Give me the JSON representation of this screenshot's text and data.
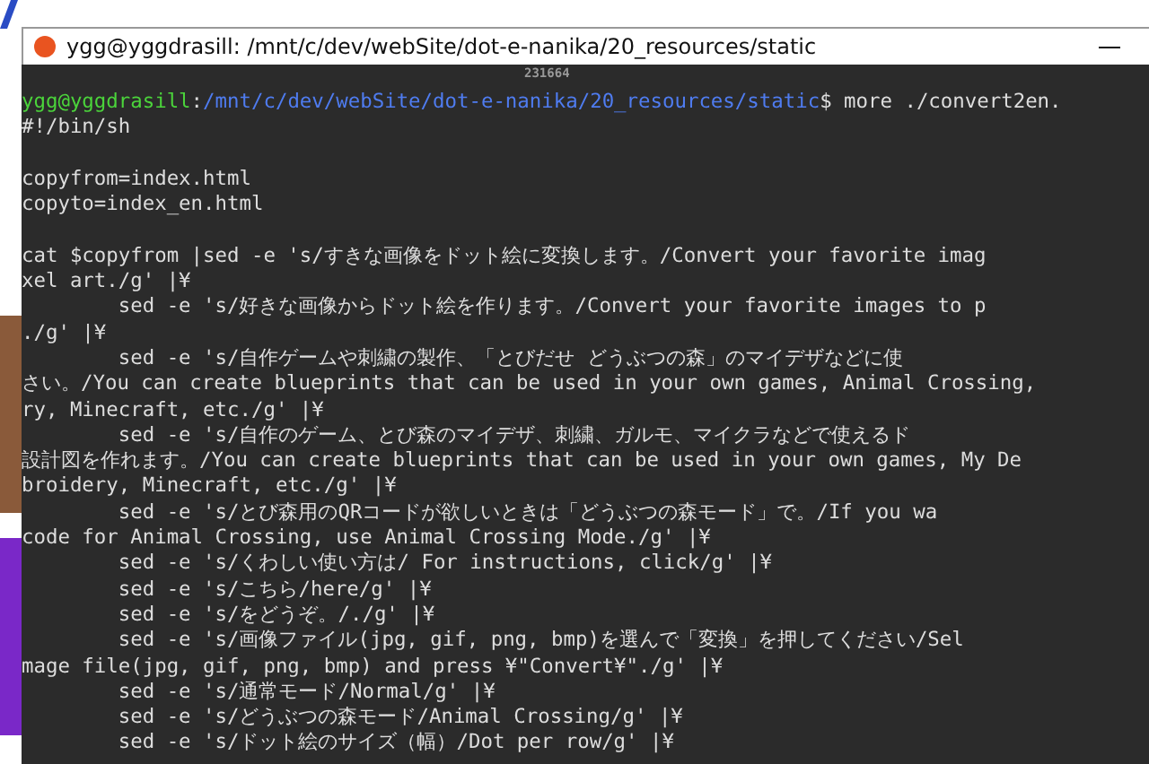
{
  "terminal": {
    "title": "ygg@yggdrasill: /mnt/c/dev/webSite/dot-e-nanika/20_resources/static",
    "counter": "231664",
    "prompt": {
      "user": "ygg@yggdrasill",
      "separator": ":",
      "path": "/mnt/c/dev/webSite/dot-e-nanika/20_resources/static",
      "command": "$ more ./convert2en."
    },
    "blocks": [
      [
        "#!/bin/sh"
      ],
      [
        "copyfrom=index.html",
        "copyto=index_en.html"
      ],
      [
        "cat $copyfrom |sed -e 's/すきな画像をドット絵に変換します。/Convert your favorite imag",
        "xel art./g' |¥",
        "        sed -e 's/好きな画像からドット絵を作ります。/Convert your favorite images to p",
        "./g' |¥",
        "        sed -e 's/自作ゲームや刺繍の製作、「とびだせ どうぶつの森」のマイデザなどに使",
        "さい。/You can create blueprints that can be used in your own games, Animal Crossing,",
        "ry, Minecraft, etc./g' |¥",
        "        sed -e 's/自作のゲーム、とび森のマイデザ、刺繍、ガルモ、マイクラなどで使えるド",
        "設計図を作れます。/You can create blueprints that can be used in your own games, My De",
        "broidery, Minecraft, etc./g' |¥",
        "        sed -e 's/とび森用のQRコードが欲しいときは「どうぶつの森モード」で。/If you wa",
        "code for Animal Crossing, use Animal Crossing Mode./g' |¥",
        "        sed -e 's/くわしい使い方は/ For instructions, click/g' |¥",
        "        sed -e 's/こちら/here/g' |¥",
        "        sed -e 's/をどうぞ。/./g' |¥",
        "        sed -e 's/画像ファイル(jpg, gif, png, bmp)を選んで「変換」を押してください/Sel",
        "mage file(jpg, gif, png, bmp) and press ¥\"Convert¥\"./g' |¥",
        "        sed -e 's/通常モード/Normal/g' |¥",
        "        sed -e 's/どうぶつの森モード/Animal Crossing/g' |¥",
        "        sed -e 's/ドット絵のサイズ（幅）/Dot per row/g' |¥"
      ]
    ]
  }
}
